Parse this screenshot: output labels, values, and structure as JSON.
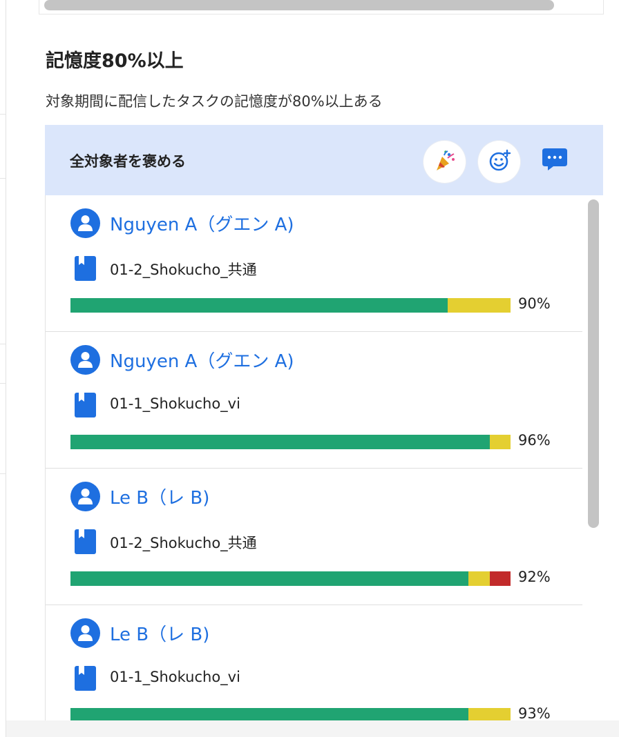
{
  "section": {
    "title": "記憶度80%以上",
    "description": "対象期間に配信したタスクの記憶度が80%以上ある"
  },
  "praise": {
    "label": "全対象者を褒める",
    "buttons": [
      {
        "icon": "party-popper-icon"
      },
      {
        "icon": "add-emoji-icon"
      },
      {
        "icon": "comment-icon"
      }
    ]
  },
  "colors": {
    "green": "#20a472",
    "yellow": "#e4cf31",
    "red": "#c22b2b",
    "accent": "#1e6fe0",
    "praise_bg": "#dbe6fb"
  },
  "rows": [
    {
      "user": "Nguyen A（グエン A)",
      "task": "01-2_Shokucho_共通",
      "percent": "90%",
      "green": 0.857,
      "yellow": 0.143,
      "red": 0
    },
    {
      "user": "Nguyen A（グエン A)",
      "task": "01-1_Shokucho_vi",
      "percent": "96%",
      "green": 0.953,
      "yellow": 0.047,
      "red": 0
    },
    {
      "user": "Le B（レ B)",
      "task": "01-2_Shokucho_共通",
      "percent": "92%",
      "green": 0.905,
      "yellow": 0.048,
      "red": 0.047
    },
    {
      "user": "Le B（レ B)",
      "task": "01-1_Shokucho_vi",
      "percent": "93%",
      "green": 0.905,
      "yellow": 0.095,
      "red": 0
    }
  ]
}
